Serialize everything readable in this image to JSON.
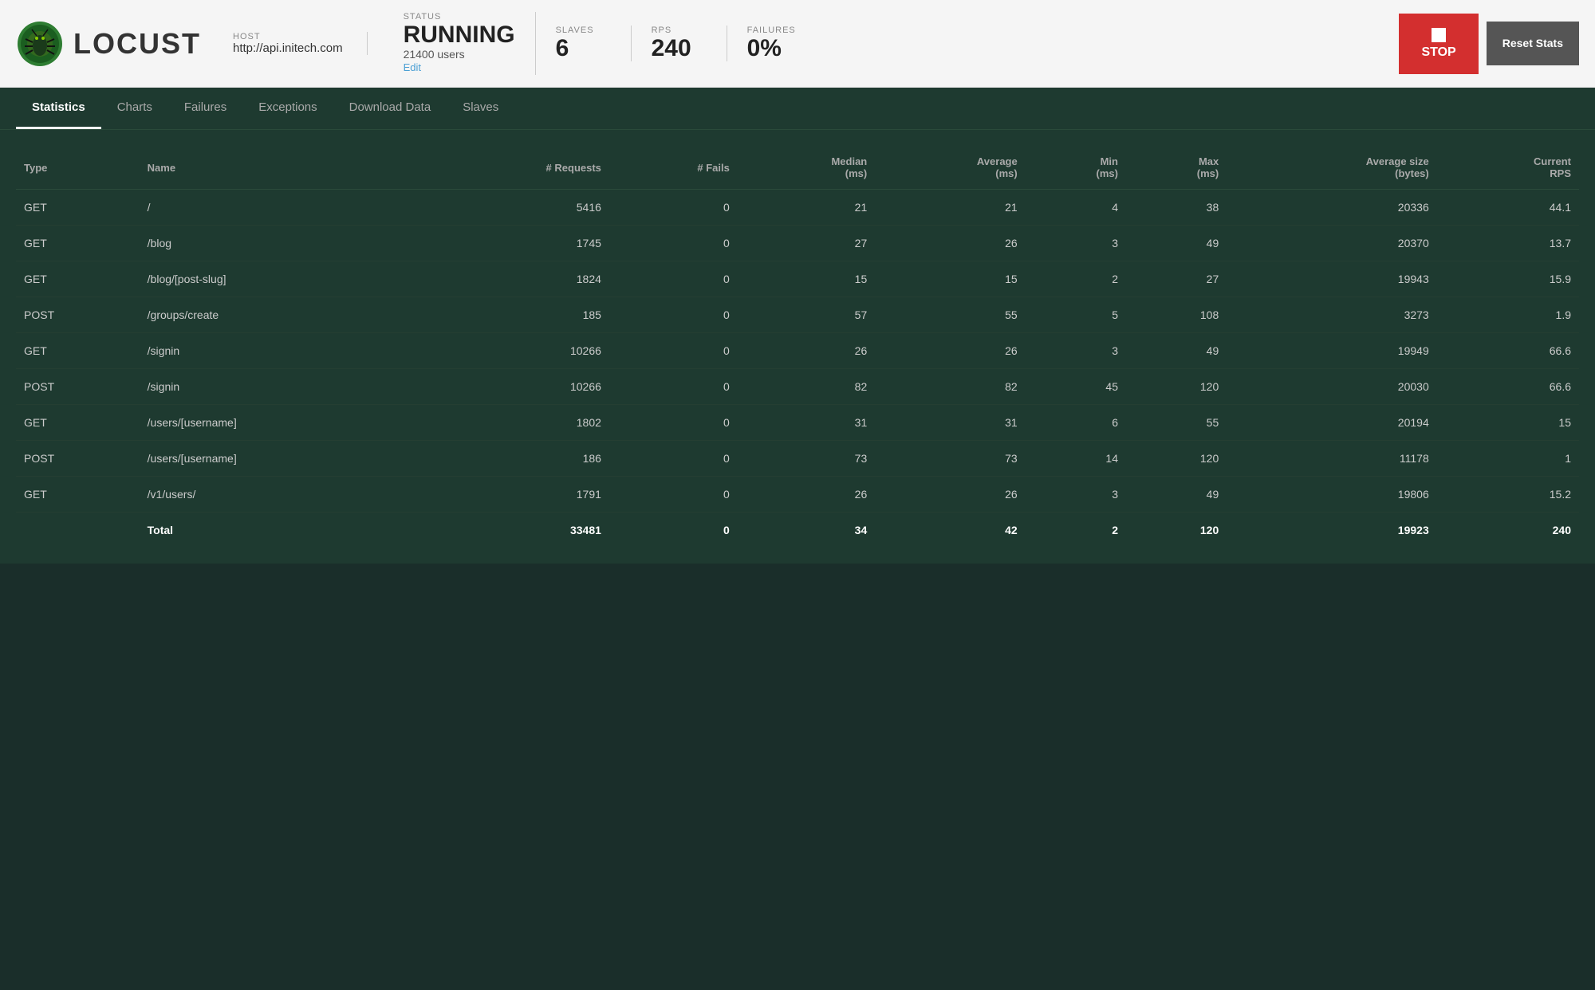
{
  "header": {
    "logo_text": "LOCUST",
    "host_label": "HOST",
    "host_value": "http://api.initech.com",
    "status_label": "STATUS",
    "status_value": "RUNNING",
    "users_value": "21400 users",
    "edit_label": "Edit",
    "slaves_label": "SLAVES",
    "slaves_value": "6",
    "rps_label": "RPS",
    "rps_value": "240",
    "failures_label": "FAILURES",
    "failures_value": "0%",
    "stop_label": "STOP",
    "reset_label": "Reset Stats"
  },
  "nav": {
    "tabs": [
      {
        "id": "statistics",
        "label": "Statistics",
        "active": true
      },
      {
        "id": "charts",
        "label": "Charts",
        "active": false
      },
      {
        "id": "failures",
        "label": "Failures",
        "active": false
      },
      {
        "id": "exceptions",
        "label": "Exceptions",
        "active": false
      },
      {
        "id": "download-data",
        "label": "Download Data",
        "active": false
      },
      {
        "id": "slaves",
        "label": "Slaves",
        "active": false
      }
    ]
  },
  "table": {
    "columns": [
      {
        "id": "type",
        "label": "Type"
      },
      {
        "id": "name",
        "label": "Name"
      },
      {
        "id": "requests",
        "label": "# Requests"
      },
      {
        "id": "fails",
        "label": "# Fails"
      },
      {
        "id": "median",
        "label": "Median (ms)"
      },
      {
        "id": "average",
        "label": "Average (ms)"
      },
      {
        "id": "min",
        "label": "Min (ms)"
      },
      {
        "id": "max",
        "label": "Max (ms)"
      },
      {
        "id": "avg_size",
        "label": "Average size (bytes)"
      },
      {
        "id": "current_rps",
        "label": "Current RPS"
      }
    ],
    "rows": [
      {
        "type": "GET",
        "name": "/",
        "requests": "5416",
        "fails": "0",
        "median": "21",
        "average": "21",
        "min": "4",
        "max": "38",
        "avg_size": "20336",
        "current_rps": "44.1"
      },
      {
        "type": "GET",
        "name": "/blog",
        "requests": "1745",
        "fails": "0",
        "median": "27",
        "average": "26",
        "min": "3",
        "max": "49",
        "avg_size": "20370",
        "current_rps": "13.7"
      },
      {
        "type": "GET",
        "name": "/blog/[post-slug]",
        "requests": "1824",
        "fails": "0",
        "median": "15",
        "average": "15",
        "min": "2",
        "max": "27",
        "avg_size": "19943",
        "current_rps": "15.9"
      },
      {
        "type": "POST",
        "name": "/groups/create",
        "requests": "185",
        "fails": "0",
        "median": "57",
        "average": "55",
        "min": "5",
        "max": "108",
        "avg_size": "3273",
        "current_rps": "1.9"
      },
      {
        "type": "GET",
        "name": "/signin",
        "requests": "10266",
        "fails": "0",
        "median": "26",
        "average": "26",
        "min": "3",
        "max": "49",
        "avg_size": "19949",
        "current_rps": "66.6"
      },
      {
        "type": "POST",
        "name": "/signin",
        "requests": "10266",
        "fails": "0",
        "median": "82",
        "average": "82",
        "min": "45",
        "max": "120",
        "avg_size": "20030",
        "current_rps": "66.6"
      },
      {
        "type": "GET",
        "name": "/users/[username]",
        "requests": "1802",
        "fails": "0",
        "median": "31",
        "average": "31",
        "min": "6",
        "max": "55",
        "avg_size": "20194",
        "current_rps": "15"
      },
      {
        "type": "POST",
        "name": "/users/[username]",
        "requests": "186",
        "fails": "0",
        "median": "73",
        "average": "73",
        "min": "14",
        "max": "120",
        "avg_size": "11178",
        "current_rps": "1"
      },
      {
        "type": "GET",
        "name": "/v1/users/",
        "requests": "1791",
        "fails": "0",
        "median": "26",
        "average": "26",
        "min": "3",
        "max": "49",
        "avg_size": "19806",
        "current_rps": "15.2"
      }
    ],
    "totals": {
      "label": "Total",
      "requests": "33481",
      "fails": "0",
      "median": "34",
      "average": "42",
      "min": "2",
      "max": "120",
      "avg_size": "19923",
      "current_rps": "240"
    }
  }
}
